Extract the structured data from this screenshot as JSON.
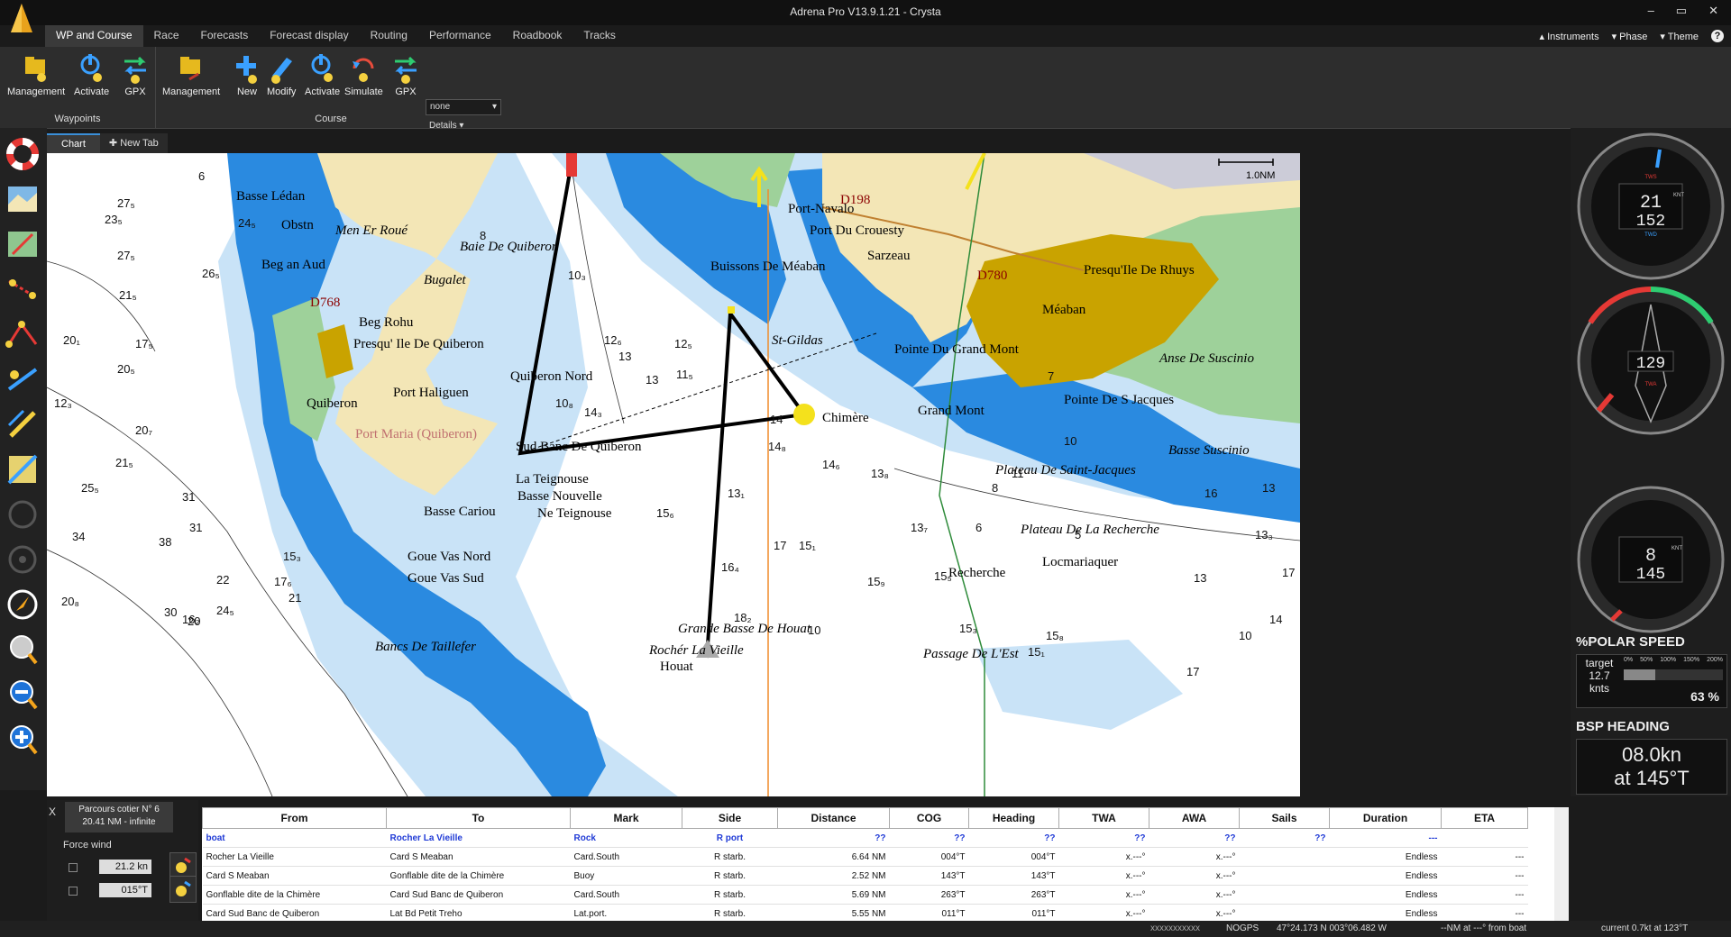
{
  "app": {
    "title": "Adrena Pro V13.9.1.21 - Crysta"
  },
  "window_controls": [
    "–",
    "▭",
    "✕"
  ],
  "tabs": [
    "WP and Course",
    "Race",
    "Forecasts",
    "Forecast display",
    "Routing",
    "Performance",
    "Roadbook",
    "Tracks"
  ],
  "right_menu": {
    "instruments": "Instruments",
    "phase": "Phase",
    "theme": "Theme",
    "help": "?"
  },
  "ribbon": {
    "waypoints": {
      "label": "Waypoints",
      "buttons": [
        "Management",
        "Activate",
        "GPX"
      ]
    },
    "course": {
      "label": "Course",
      "buttons": [
        "Management",
        "New",
        "Modify",
        "Activate",
        "Simulate",
        "GPX"
      ]
    },
    "dropdown_value": "none",
    "details": "Details"
  },
  "chart_tabs": {
    "chart": "Chart",
    "new_tab": "New Tab"
  },
  "map": {
    "scale": "1.0NM",
    "labels": [
      {
        "t": "Basse Lédan",
        "c": "#000",
        "i": false
      },
      {
        "t": "Obstn",
        "c": "#000",
        "i": false
      },
      {
        "t": "Men Er Roué",
        "c": "#000",
        "i": true
      },
      {
        "t": "Baie De Quiberon",
        "c": "#000",
        "i": true
      },
      {
        "t": "Beg an Aud",
        "c": "#000",
        "i": false
      },
      {
        "t": "Bugalet",
        "c": "#000",
        "i": true
      },
      {
        "t": "Beg Rohu",
        "c": "#000",
        "i": false
      },
      {
        "t": "Presqu' Ile De Quiberon",
        "c": "#000",
        "i": false
      },
      {
        "t": "Port Haliguen",
        "c": "#000",
        "i": false
      },
      {
        "t": "Quiberon",
        "c": "#000",
        "i": false
      },
      {
        "t": "Port Maria (Quiberon)",
        "c": "#c07070",
        "i": false
      },
      {
        "t": "Quiberon Nord",
        "c": "#000",
        "i": false
      },
      {
        "t": "Sud Banc De Quiberon",
        "c": "#000",
        "i": false
      },
      {
        "t": "La Teignouse",
        "c": "#000",
        "i": false
      },
      {
        "t": "Basse Nouvelle",
        "c": "#000",
        "i": false
      },
      {
        "t": "Ne Teignouse",
        "c": "#000",
        "i": false
      },
      {
        "t": "Basse Cariou",
        "c": "#000",
        "i": false
      },
      {
        "t": "Goue Vas Nord",
        "c": "#000",
        "i": false
      },
      {
        "t": "Goue Vas Sud",
        "c": "#000",
        "i": false
      },
      {
        "t": "Bancs De Taillefer",
        "c": "#000",
        "i": true
      },
      {
        "t": "Houat",
        "c": "#000",
        "i": false
      },
      {
        "t": "Port-Navalo",
        "c": "#000",
        "i": false
      },
      {
        "t": "Port Du Crouesty",
        "c": "#000",
        "i": false
      },
      {
        "t": "Sarzeau",
        "c": "#000",
        "i": false
      },
      {
        "t": "Presqu'Ile De Rhuys",
        "c": "#000",
        "i": false
      },
      {
        "t": "Méaban",
        "c": "#000",
        "i": false
      },
      {
        "t": "Buissons De Méaban",
        "c": "#000",
        "i": false
      },
      {
        "t": "St-Gildas",
        "c": "#000",
        "i": true
      },
      {
        "t": "Pointe Du Grand Mont",
        "c": "#000",
        "i": false
      },
      {
        "t": "Grand Mont",
        "c": "#000",
        "i": false
      },
      {
        "t": "Chimère",
        "c": "#000",
        "i": false
      },
      {
        "t": "Pointe De S Jacques",
        "c": "#000",
        "i": false
      },
      {
        "t": "Anse De Suscinio",
        "c": "#000",
        "i": true
      },
      {
        "t": "Basse Suscinio",
        "c": "#000",
        "i": true
      },
      {
        "t": "Plateau De Saint-Jacques",
        "c": "#000",
        "i": true
      },
      {
        "t": "Plateau De La Recherche",
        "c": "#000",
        "i": true
      },
      {
        "t": "Locmariaquer",
        "c": "#000",
        "i": false
      },
      {
        "t": "Recherche",
        "c": "#000",
        "i": false
      },
      {
        "t": "Grande Basse De Houat",
        "c": "#000",
        "i": true
      },
      {
        "t": "Rochér La Vieille",
        "c": "#000",
        "i": true
      },
      {
        "t": "Passage De L'Est",
        "c": "#000",
        "i": true
      },
      {
        "t": "D198",
        "c": "#8b0000",
        "i": false
      },
      {
        "t": "D780",
        "c": "#8b0000",
        "i": false
      },
      {
        "t": "D768",
        "c": "#8b0000",
        "i": false
      }
    ],
    "depths": [
      "6",
      "27₅",
      "23₅",
      "24₅",
      "27₅",
      "26₅",
      "21₅",
      "20₁",
      "17₅",
      "20₅",
      "12₃",
      "20₇",
      "21₅",
      "25₅",
      "31",
      "31",
      "34",
      "38",
      "22",
      "20₈",
      "21",
      "16₂",
      "24₅",
      "15₃",
      "20",
      "17₆",
      "30",
      "8",
      "10₃",
      "12₆",
      "13",
      "12₅",
      "11₅",
      "14₃",
      "10₈",
      "13",
      "14",
      "14₈",
      "14₆",
      "13₈",
      "13₁",
      "15₆",
      "18₂",
      "17",
      "16₄",
      "15₉",
      "15₁",
      "15₅",
      "13₇",
      "15₃",
      "15₈",
      "15₁",
      "13₃",
      "16",
      "14",
      "13",
      "13",
      "17",
      "17",
      "10",
      "10",
      "10",
      "11",
      "8",
      "7",
      "6",
      "5"
    ]
  },
  "instruments": {
    "wind": {
      "tws": "21",
      "twd": "152",
      "tws_unit": "KNT",
      "label_tws": "TWS",
      "label_twd": "TWD"
    },
    "twa": {
      "value": "129",
      "label": "TWA"
    },
    "speed": {
      "value": "8",
      "unit": "KNT",
      "heading": "145"
    },
    "polar": {
      "title": "%POLAR SPEED",
      "target_label": "target",
      "target_value": "12.7",
      "target_unit": "knts",
      "percent": "63 %",
      "scale": [
        "0%",
        "50%",
        "100%",
        "150%",
        "200%"
      ]
    },
    "bsp": {
      "title": "BSP HEADING",
      "speed": "08.0kn",
      "heading": "at 145°T"
    }
  },
  "course_panel": {
    "close": "X",
    "name": "Parcours cotier N° 6",
    "distance": "20.41 NM - infinite",
    "force_wind_label": "Force wind",
    "wind_speed": "21.2 kn",
    "wind_dir": "015°T"
  },
  "table": {
    "headers": [
      "From",
      "To",
      "Mark",
      "Side",
      "Distance",
      "COG",
      "Heading",
      "TWA",
      "AWA",
      "Sails",
      "Duration",
      "ETA"
    ],
    "rows": [
      [
        "boat",
        "Rocher La Vieille",
        "Rock",
        "R port",
        "??",
        "??",
        "??",
        "??",
        "??",
        "??",
        "---",
        ""
      ],
      [
        "Rocher La Vieille",
        "Card S Meaban",
        "Card.South",
        "R starb.",
        "6.64 NM",
        "004°T",
        "004°T",
        "x.---°",
        "x.---°",
        "",
        "Endless",
        "---"
      ],
      [
        "Card S Meaban",
        "Gonflable dite de la Chimère",
        "Buoy",
        "R starb.",
        "2.52 NM",
        "143°T",
        "143°T",
        "x.---°",
        "x.---°",
        "",
        "Endless",
        "---"
      ],
      [
        "Gonflable dite de la Chimère",
        "Card Sud Banc de Quiberon",
        "Card.South",
        "R starb.",
        "5.69 NM",
        "263°T",
        "263°T",
        "x.---°",
        "x.---°",
        "",
        "Endless",
        "---"
      ],
      [
        "Card Sud Banc de Quiberon",
        "Lat Bd Petit Treho",
        "Lat.port.",
        "R starb.",
        "5.55 NM",
        "011°T",
        "011°T",
        "x.---°",
        "x.---°",
        "",
        "Endless",
        "---"
      ]
    ]
  },
  "status": {
    "xx": "xxxxxxxxxxx",
    "gps": "NOGPS",
    "position": "47°24.173 N  003°06.482 W",
    "from_boat": "--NM at ---° from boat",
    "current": "current 0.7kt at 123°T"
  },
  "colors": {
    "land": "#f3e6b6",
    "sea_deep": "#ffffff",
    "sea_light": "#c9e3f7",
    "sea_shallow": "#2a8ae0",
    "intertidal": "#9ed19a",
    "urban": "#c9a300"
  }
}
